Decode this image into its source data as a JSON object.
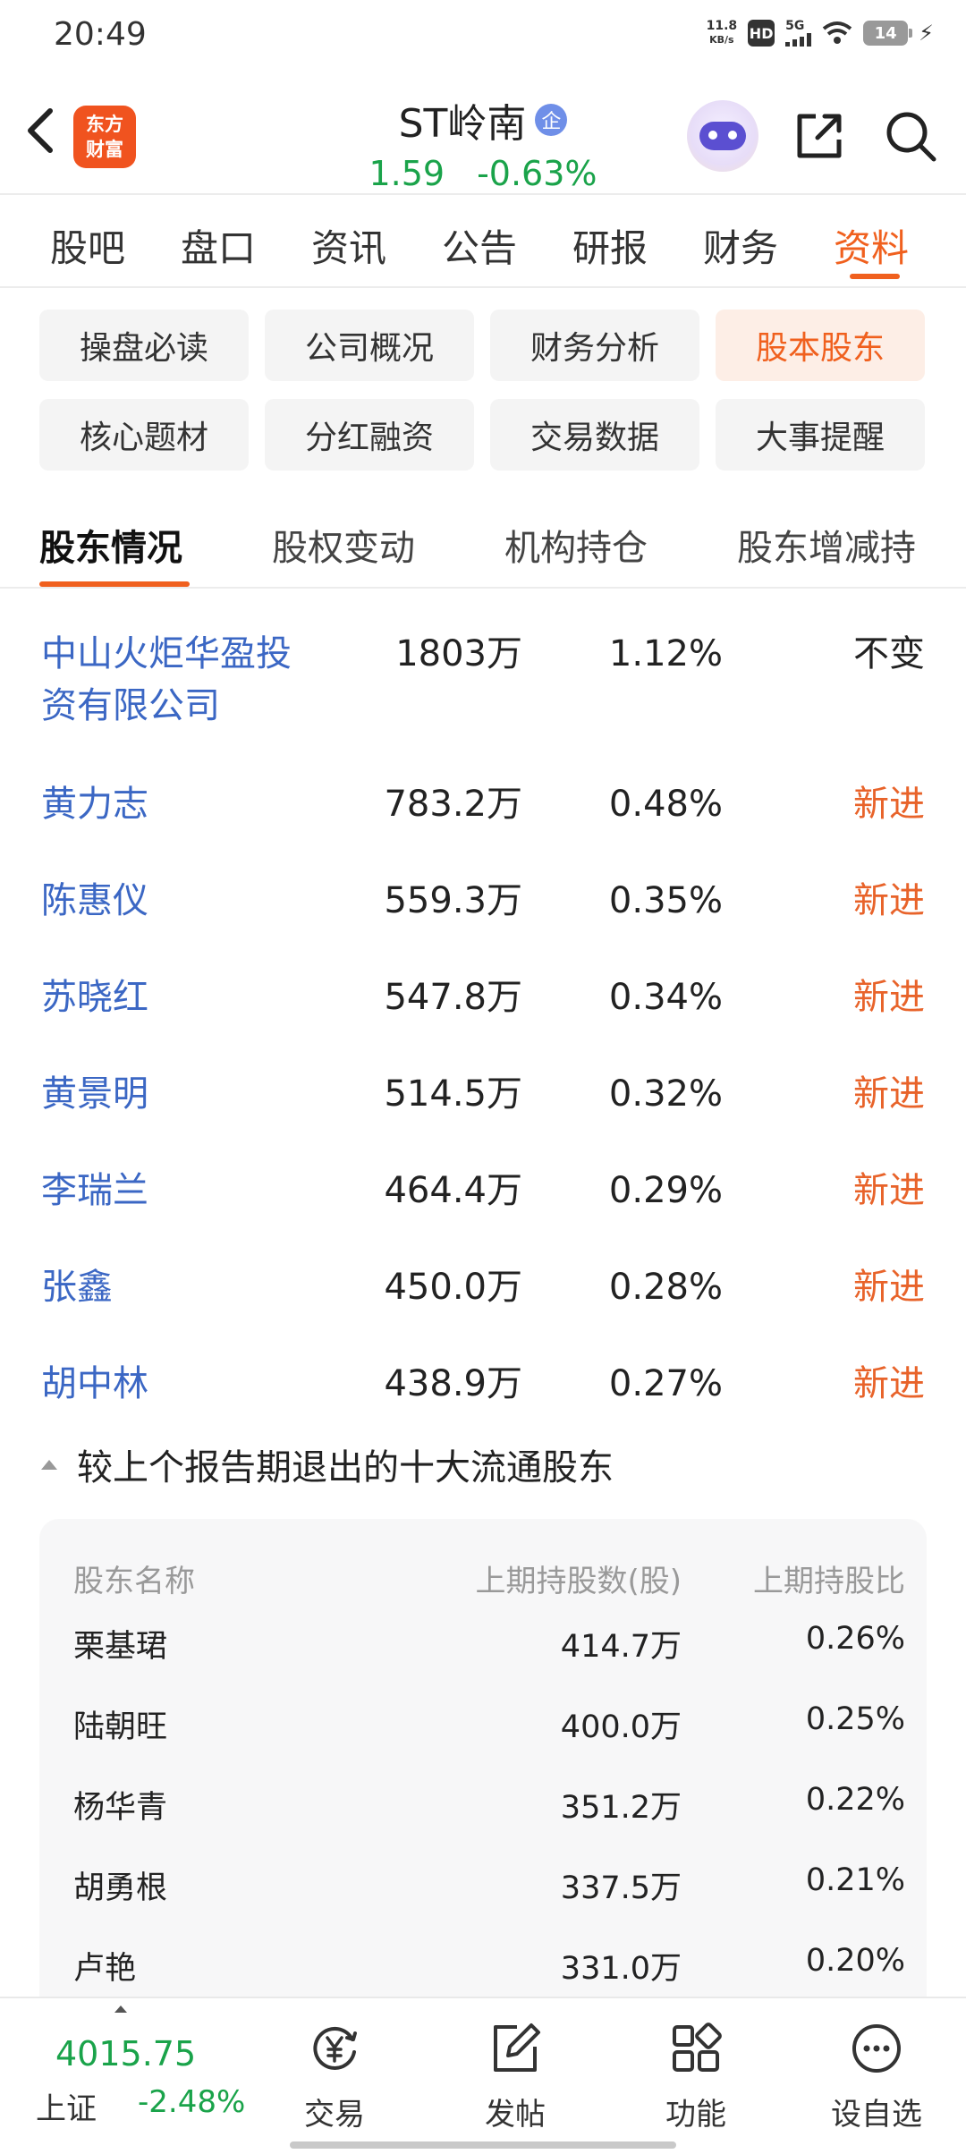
{
  "status": {
    "time": "20:49",
    "net_speed_value": "11.8",
    "net_speed_unit": "KB/s",
    "hd": "HD",
    "network": "5G",
    "battery": "14"
  },
  "header": {
    "logo_line1": "东方",
    "logo_line2": "财富",
    "stock_name": "ST岭南",
    "badge": "企",
    "price": "1.59",
    "change": "-0.63%"
  },
  "main_tabs": [
    "股吧",
    "盘口",
    "资讯",
    "公告",
    "研报",
    "财务",
    "资料"
  ],
  "active_main_tab": "资料",
  "sub_tabs": [
    "操盘必读",
    "公司概况",
    "财务分析",
    "股本股东",
    "核心题材",
    "分红融资",
    "交易数据",
    "大事提醒"
  ],
  "active_sub_tab": "股本股东",
  "section_tabs": [
    "股东情况",
    "股权变动",
    "机构持仓",
    "股东增减持"
  ],
  "active_section_tab": "股东情况",
  "holders": [
    {
      "name_line1": "中山火炬华盈投",
      "name_line2": "资有限公司",
      "shares": "1803万",
      "ratio": "1.12%",
      "change": "不变"
    },
    {
      "name_line1": "黄力志",
      "name_line2": "",
      "shares": "783.2万",
      "ratio": "0.48%",
      "change": "新进"
    },
    {
      "name_line1": "陈惠仪",
      "name_line2": "",
      "shares": "559.3万",
      "ratio": "0.35%",
      "change": "新进"
    },
    {
      "name_line1": "苏晓红",
      "name_line2": "",
      "shares": "547.8万",
      "ratio": "0.34%",
      "change": "新进"
    },
    {
      "name_line1": "黄景明",
      "name_line2": "",
      "shares": "514.5万",
      "ratio": "0.32%",
      "change": "新进"
    },
    {
      "name_line1": "李瑞兰",
      "name_line2": "",
      "shares": "464.4万",
      "ratio": "0.29%",
      "change": "新进"
    },
    {
      "name_line1": "张鑫",
      "name_line2": "",
      "shares": "450.0万",
      "ratio": "0.28%",
      "change": "新进"
    },
    {
      "name_line1": "胡中林",
      "name_line2": "",
      "shares": "438.9万",
      "ratio": "0.27%",
      "change": "新进"
    }
  ],
  "exited": {
    "title": "较上个报告期退出的十大流通股东",
    "headers": [
      "股东名称",
      "上期持股数(股)",
      "上期持股比"
    ],
    "rows": [
      {
        "name": "栗基珺",
        "shares": "414.7万",
        "ratio": "0.26%"
      },
      {
        "name": "陆朝旺",
        "shares": "400.0万",
        "ratio": "0.25%"
      },
      {
        "name": "杨华青",
        "shares": "351.2万",
        "ratio": "0.22%"
      },
      {
        "name": "胡勇根",
        "shares": "337.5万",
        "ratio": "0.21%"
      },
      {
        "name": "卢艳",
        "shares": "331.0万",
        "ratio": "0.20%"
      }
    ]
  },
  "bottom": {
    "index_value": "4015.75",
    "index_name": "上证",
    "index_change": "-2.48%",
    "nav": [
      {
        "label": "交易",
        "icon": "yuan-trade-icon"
      },
      {
        "label": "发帖",
        "icon": "edit-post-icon"
      },
      {
        "label": "功能",
        "icon": "grid-function-icon"
      },
      {
        "label": "设自选",
        "icon": "more-dots-icon"
      }
    ]
  },
  "colors": {
    "accent": "#f0601e",
    "down_green": "#1aa34a",
    "link_blue": "#3b67c4",
    "new_orange": "#e8632a"
  }
}
